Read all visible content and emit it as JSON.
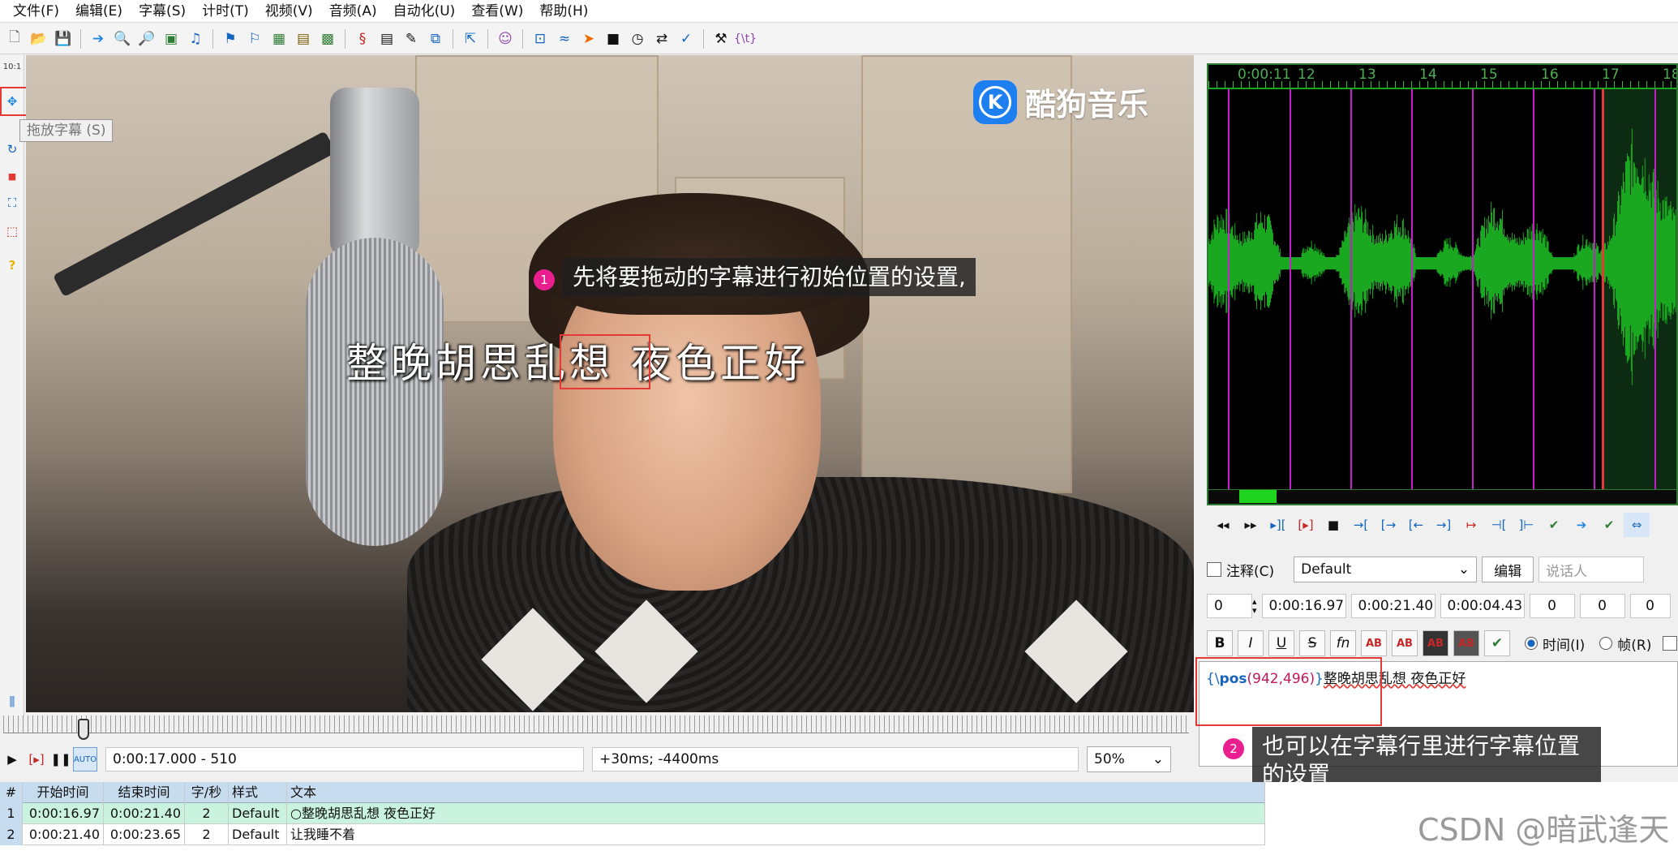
{
  "menu": [
    "文件(F)",
    "编辑(E)",
    "字幕(S)",
    "计时(T)",
    "视频(V)",
    "音频(A)",
    "自动化(U)",
    "查看(W)",
    "帮助(H)"
  ],
  "toolbar_icons": [
    "new-file-icon",
    "open-file-icon",
    "save-icon",
    "jump-icon",
    "zoom-in-icon",
    "zoom-out-icon",
    "video-icon",
    "audio-icon",
    "bookmark-icon",
    "bookmark2-icon",
    "grid-icon",
    "film-icon",
    "keyframe-icon",
    "script-icon",
    "doc-icon",
    "pencil-icon",
    "copy-icon",
    "resample-icon",
    "avatar-icon",
    "snap-icon",
    "waveform-icon",
    "arrow-icon",
    "stop-icon",
    "clock-icon",
    "shift-icon",
    "spellcheck-icon",
    "tools-icon",
    "lua-icon"
  ],
  "left_tools": {
    "zoom_label": "10:1",
    "tooltip": "拖放字幕 (S)"
  },
  "video": {
    "logo_text": "酷狗音乐",
    "subtitle": "整晚胡思乱想 夜色正好"
  },
  "callouts": [
    {
      "num": "1",
      "text": "先将要拖动的字幕进行初始位置的设置,"
    },
    {
      "num": "2",
      "text": "也可以在字幕行里进行字幕位置的设置"
    }
  ],
  "playback": {
    "time_frame": "0:00:17.000 - 510",
    "offset": "+30ms; -4400ms",
    "zoom": "50%"
  },
  "audio": {
    "ruler_labels": [
      "0:00:11",
      "12",
      "13",
      "14",
      "15",
      "16",
      "17",
      "18"
    ]
  },
  "edit": {
    "comment_label": "注释(C)",
    "style": "Default",
    "edit_button": "编辑",
    "actor_placeholder": "说话人",
    "layer": "0",
    "start": "0:00:16.97",
    "end": "0:00:21.40",
    "duration": "0:00:04.43",
    "margin_l": "0",
    "margin_r": "0",
    "margin_v": "0",
    "time_radio": "时间(I)",
    "frame_radio": "帧(R)",
    "text_tag_open": "{\\",
    "text_tag_name": "pos",
    "text_tag_args": "(942,496)",
    "text_tag_close": "}",
    "text_body": "整晚胡思乱想 夜色正好"
  },
  "grid": {
    "headers": [
      "#",
      "开始时间",
      "结束时间",
      "字/秒",
      "样式",
      "文本"
    ],
    "rows": [
      {
        "num": "1",
        "start": "0:00:16.97",
        "end": "0:00:21.40",
        "cps": "2",
        "style": "Default",
        "text": "○整晚胡思乱想 夜色正好"
      },
      {
        "num": "2",
        "start": "0:00:21.40",
        "end": "0:00:23.65",
        "cps": "2",
        "style": "Default",
        "text": "让我睡不着"
      }
    ]
  },
  "watermark": "CSDN @暗武逢天",
  "colors": {
    "accent_magenta": "#e91e8f",
    "wave_green": "#19a81f",
    "annotation_red": "#e53935"
  }
}
